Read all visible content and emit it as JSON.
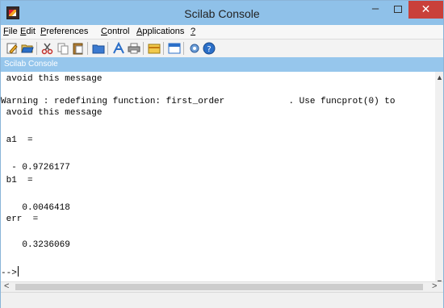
{
  "window": {
    "title": "Scilab Console"
  },
  "titlebar_buttons": {
    "minimize": "–",
    "close": "✕"
  },
  "menu": [
    {
      "ul": "F",
      "rest": "ile"
    },
    {
      "ul": "E",
      "rest": "dit"
    },
    {
      "ul": "P",
      "rest": "references"
    },
    {
      "ul": "C",
      "rest": "ontrol"
    },
    {
      "ul": "A",
      "rest": "pplications"
    },
    {
      "ul": "?",
      "rest": ""
    }
  ],
  "toolbar": {
    "icons": [
      "new-script-icon",
      "open-file-icon",
      "cut-icon",
      "copy-icon",
      "paste-icon",
      "change-directory-icon",
      "font-icon",
      "print-icon",
      "clear-console-icon",
      "variable-browser-icon",
      "module-manager-icon",
      "help-icon"
    ]
  },
  "dock": {
    "title": "Scilab Console"
  },
  "console": {
    "lines": [
      " avoid this message",
      "",
      "Warning : redefining function: first_order            . Use funcprot(0) to",
      " avoid this message",
      "",
      " a1  =",
      "",
      "  - 0.9726177",
      " b1  =",
      "",
      "    0.0046418",
      " err  =",
      "",
      "    0.3236069",
      "",
      ""
    ],
    "prompt": "-->"
  },
  "scroll": {
    "up": "▲",
    "down": "▼",
    "left": "<",
    "right": ">"
  }
}
